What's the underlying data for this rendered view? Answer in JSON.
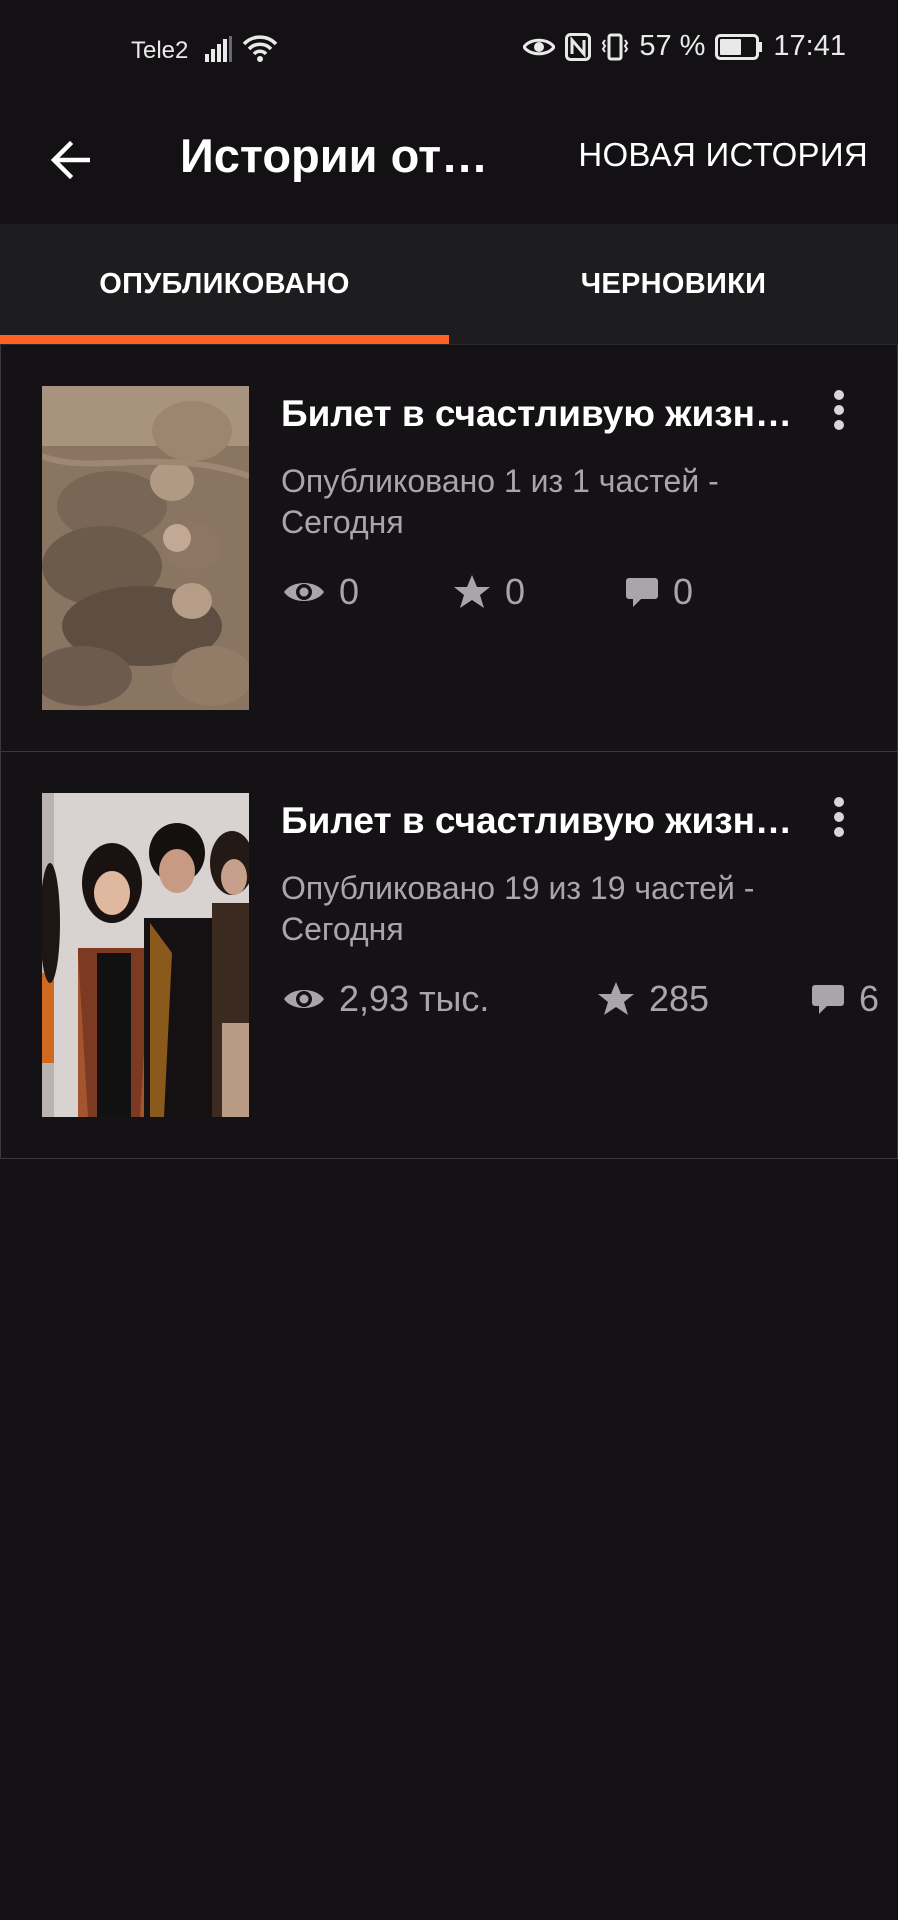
{
  "status_bar": {
    "carrier": "Tele2",
    "battery_percent": "57 %",
    "time": "17:41"
  },
  "app_bar": {
    "title": "Истории от…",
    "new_story_label": "НОВАЯ ИСТОРИЯ"
  },
  "tabs": [
    {
      "label": "ОПУБЛИКОВАНО",
      "active": true
    },
    {
      "label": "ЧЕРНОВИКИ",
      "active": false
    }
  ],
  "colors": {
    "accent": "#ff6122",
    "background": "#131114",
    "tab_bar": "#1d1c1f",
    "muted_text": "#a8a6aa"
  },
  "stories": [
    {
      "title": "Билет в счастливую жизн…",
      "meta": "Опубликовано 1 из 1 частей - Сегодня",
      "views": "0",
      "votes": "0",
      "comments": "0"
    },
    {
      "title": "Билет в счастливую жизн…",
      "meta": "Опубликовано 19 из 19 частей - Сегодня",
      "views": "2,93 тыс.",
      "votes": "285",
      "comments": "6"
    }
  ]
}
